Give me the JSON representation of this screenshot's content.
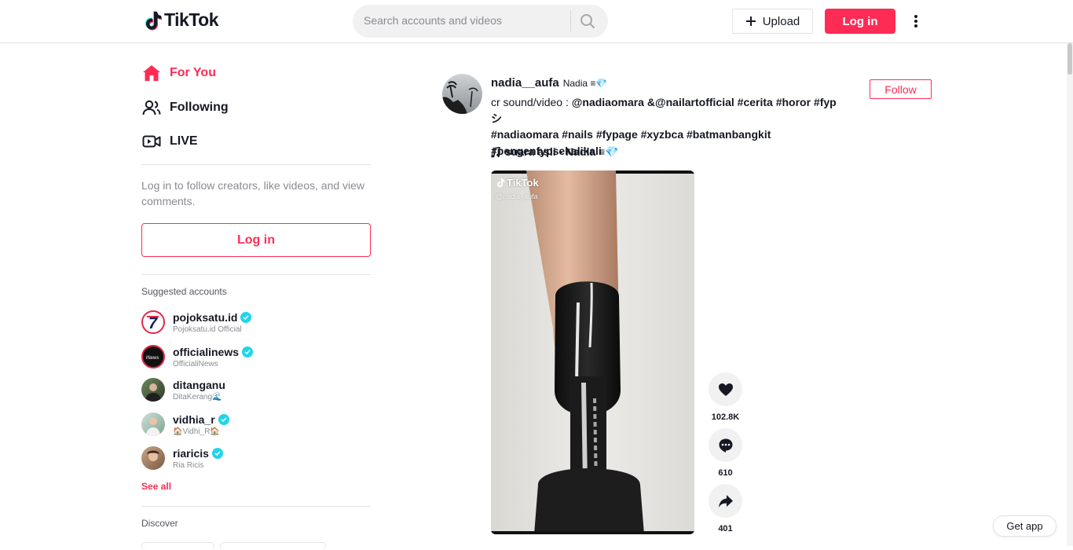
{
  "header": {
    "logo_text": "TikTok",
    "search_placeholder": "Search accounts and videos",
    "upload_label": "Upload",
    "login_label": "Log in"
  },
  "sidebar": {
    "nav": [
      {
        "label": "For You",
        "icon": "home-icon",
        "active": true
      },
      {
        "label": "Following",
        "icon": "users-icon",
        "active": false
      },
      {
        "label": "LIVE",
        "icon": "live-icon",
        "active": false
      }
    ],
    "login_prompt": "Log in to follow creators, like videos, and view comments.",
    "login_button": "Log in",
    "suggested_title": "Suggested accounts",
    "accounts": [
      {
        "username": "pojoksatu.id",
        "nickname": "Pojoksatu.id Official",
        "verified": true
      },
      {
        "username": "officialinews",
        "nickname": "OfficialiNews",
        "verified": true
      },
      {
        "username": "ditanganu",
        "nickname": "DitaKerang🌊",
        "verified": false
      },
      {
        "username": "vidhia_r",
        "nickname": "🏠Vidhi_R🏠",
        "verified": true
      },
      {
        "username": "riaricis",
        "nickname": "Ria Ricis",
        "verified": true
      }
    ],
    "see_all": "See all",
    "discover_title": "Discover"
  },
  "post": {
    "author_id": "nadia__aufa",
    "author_nickname": "Nadia ≡💎",
    "follow_label": "Follow",
    "caption_text": "cr sound/video : ",
    "caption_mentions": "@nadiaomara &@nailartofficial",
    "caption_tags_line1": " #cerita #horor #fypシ",
    "caption_tags_line2": "#nadiaomara #nails #fypage #xyzbca #batmanbangkit",
    "caption_tags_line3": "#pengenfypsekalikali",
    "music": "suara asli - Nadia ≡💎",
    "video_watermark": "TikTok",
    "video_watermark_user": "@nadia_aufa",
    "likes": "102.8K",
    "comments": "610",
    "shares": "401"
  },
  "footer": {
    "get_app": "Get app"
  },
  "colors": {
    "accent": "#fe2c55",
    "verified": "#20d5ec",
    "text": "#161823",
    "muted": "#8a8b91"
  }
}
